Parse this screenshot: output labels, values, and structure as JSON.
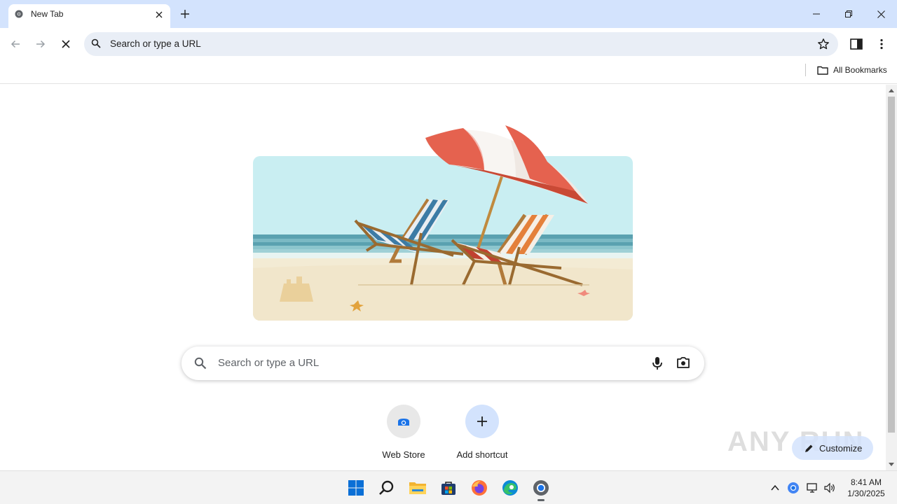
{
  "tab": {
    "title": "New Tab"
  },
  "omnibox": {
    "placeholder": "Search or type a URL"
  },
  "bookmarks": {
    "all_label": "All Bookmarks"
  },
  "search": {
    "placeholder": "Search or type a URL"
  },
  "shortcuts": [
    {
      "label": "Web Store",
      "icon": "web-store-icon"
    },
    {
      "label": "Add shortcut",
      "icon": "plus-icon"
    }
  ],
  "customize": {
    "label": "Customize"
  },
  "watermark": {
    "text": "ANY RUN"
  },
  "taskbar": {
    "time": "8:41 AM",
    "date": "1/30/2025",
    "apps": [
      "windows-start-icon",
      "search-icon",
      "file-explorer-icon",
      "microsoft-store-icon",
      "firefox-icon",
      "edge-icon",
      "chrome-icon"
    ]
  },
  "colors": {
    "tabstrip": "#d3e3fd",
    "omnibox": "#e9eef6",
    "accent": "#0b57d0"
  }
}
